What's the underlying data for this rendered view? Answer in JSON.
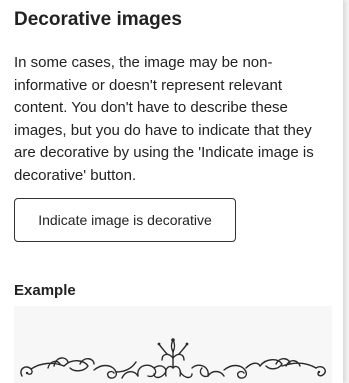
{
  "section": {
    "title": "Decorative images",
    "description": "In some cases, the image may be non-informative or doesn't represent relevant content. You don't have to describe these images, but you do have to indicate that they are decorative by using the 'Indicate image is decorative' button.",
    "button_label": "Indicate image is decorative"
  },
  "example": {
    "label": "Example",
    "image_icon": "decorative-flourish-divider"
  }
}
